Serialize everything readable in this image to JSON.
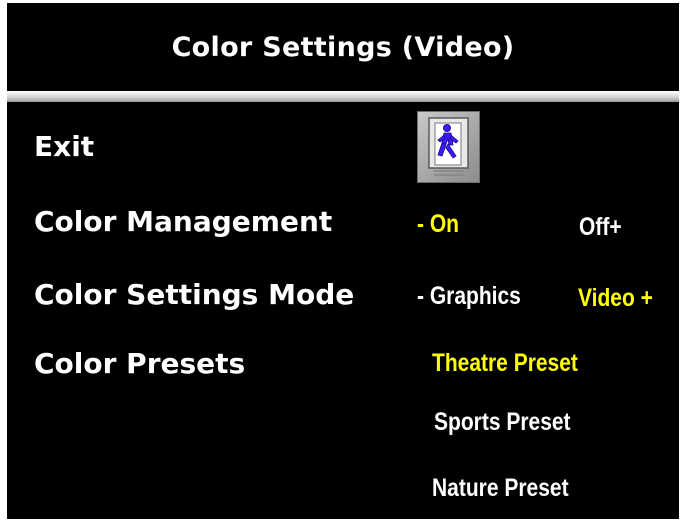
{
  "colors": {
    "background": "#000000",
    "text": "#ffffff",
    "selected": "#ffff00",
    "icon_figure": "#3b1cff",
    "icon_frame": "#a8a8a8"
  },
  "title": "Color Settings (Video)",
  "menu": {
    "exit": {
      "label": "Exit",
      "icon": "exit-door-running-figure-icon"
    },
    "color_management": {
      "label": "Color Management",
      "options": [
        {
          "text": "- On",
          "selected": true
        },
        {
          "text": "Off+",
          "selected": false
        }
      ]
    },
    "color_settings_mode": {
      "label": "Color Settings Mode",
      "options": [
        {
          "text": "- Graphics",
          "selected": false
        },
        {
          "text": "Video +",
          "selected": true
        }
      ]
    },
    "color_presets": {
      "label": "Color Presets",
      "options": [
        {
          "text": "Theatre Preset",
          "selected": true
        },
        {
          "text": "Sports Preset",
          "selected": false
        },
        {
          "text": "Nature Preset",
          "selected": false
        }
      ]
    }
  }
}
